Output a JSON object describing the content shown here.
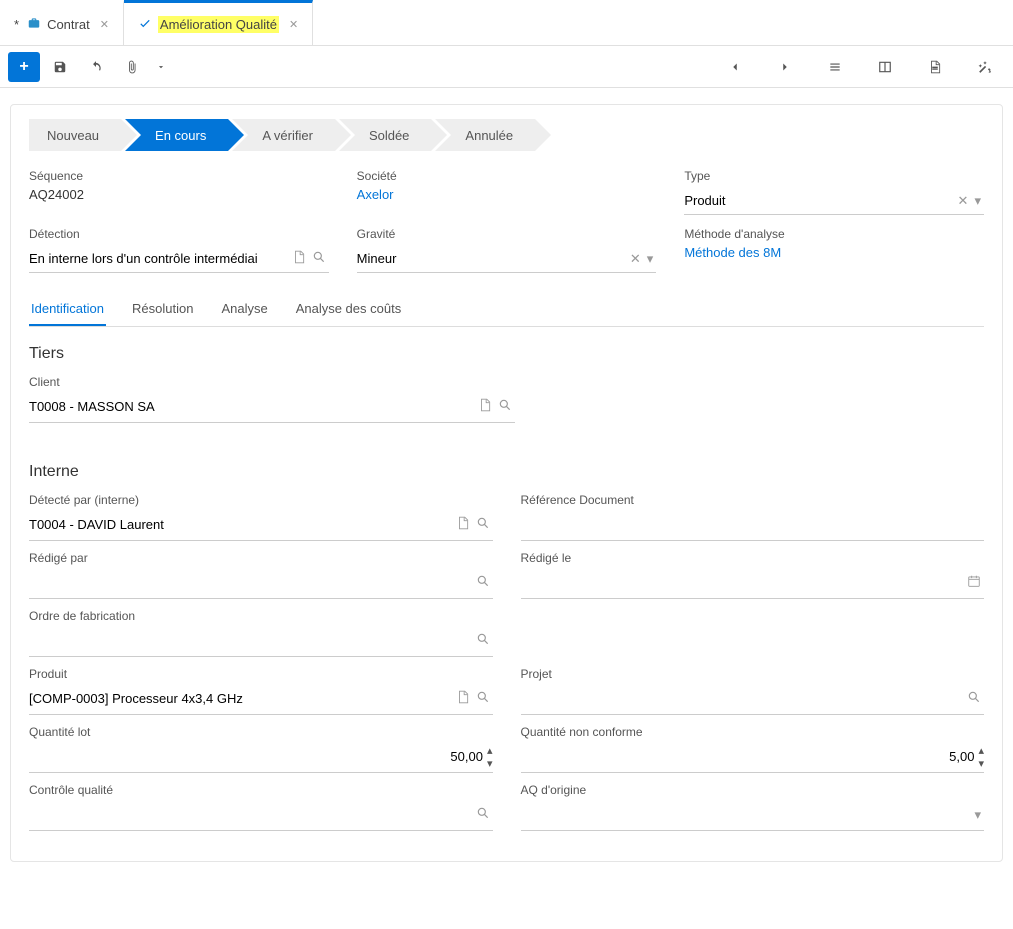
{
  "tabs": {
    "contrat": {
      "label": "Contrat",
      "dirty": "*"
    },
    "qualite": {
      "label": "Amélioration Qualité"
    }
  },
  "status": {
    "nouveau": "Nouveau",
    "encours": "En cours",
    "averifier": "A vérifier",
    "soldee": "Soldée",
    "annulee": "Annulée"
  },
  "header": {
    "sequence_label": "Séquence",
    "sequence_value": "AQ24002",
    "societe_label": "Société",
    "societe_value": "Axelor",
    "type_label": "Type",
    "type_value": "Produit",
    "detection_label": "Détection",
    "detection_value": "En interne lors d'un contrôle intermédiai",
    "gravite_label": "Gravité",
    "gravite_value": "Mineur",
    "methode_label": "Méthode d'analyse",
    "methode_value": "Méthode des 8M"
  },
  "detail_tabs": {
    "identification": "Identification",
    "resolution": "Résolution",
    "analyse": "Analyse",
    "couts": "Analyse des coûts"
  },
  "sections": {
    "tiers": "Tiers",
    "interne": "Interne"
  },
  "fields": {
    "client_label": "Client",
    "client_value": "T0008 - MASSON SA",
    "detecte_label": "Détecté par (interne)",
    "detecte_value": "T0004 - DAVID Laurent",
    "refdoc_label": "Référence Document",
    "refdoc_value": "",
    "redige_label": "Rédigé par",
    "redige_value": "",
    "redigele_label": "Rédigé le",
    "redigele_value": "",
    "ordre_label": "Ordre de fabrication",
    "ordre_value": "",
    "produit_label": "Produit",
    "produit_value": "[COMP-0003] Processeur 4x3,4 GHz",
    "projet_label": "Projet",
    "projet_value": "",
    "qtelot_label": "Quantité lot",
    "qtelot_value": "50,00",
    "qtenc_label": "Quantité non conforme",
    "qtenc_value": "5,00",
    "ctrlq_label": "Contrôle qualité",
    "ctrlq_value": "",
    "aqo_label": "AQ d'origine",
    "aqo_value": ""
  }
}
